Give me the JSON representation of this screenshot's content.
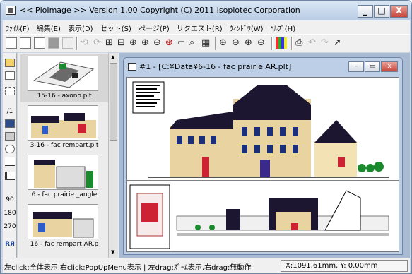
{
  "window": {
    "title": "<< PloImage >>  Version 1.00 Copyright (C) 2011 Isoplotec Corporation",
    "min": "_",
    "max": "□",
    "close": "X"
  },
  "menu": [
    "ﾌｧｲﾙ(F)",
    "編集(E)",
    "表示(D)",
    "セット(S)",
    "ページ(P)",
    "リクエスト(R)",
    "ｳｨﾝﾄﾞｳ(W)",
    "ﾍﾙﾌﾟ(H)"
  ],
  "leftbar": {
    "labels": [
      "/1",
      "90",
      "180",
      "270",
      "RЯ"
    ]
  },
  "thumbnails": [
    {
      "label": "15-16 - axono.plt"
    },
    {
      "label": "3-16 - fac rempart.plt"
    },
    {
      "label": "6 - fac prairie _angle"
    },
    {
      "label": "16 - fac rempart AR.p"
    }
  ],
  "child": {
    "title": "#1 - [C:¥Data¥6-16 - fac prairie AR.plt]"
  },
  "status": {
    "help": "左click:全体表示,右click:PopUpMenu表示 | 左drag:ｽﾞｰﾑ表示,右drag:無動作",
    "coords": "X:1091.61mm, Y: 0.00mm"
  },
  "colors": {
    "accent": "#3a6fb0",
    "building_dark": "#1c1630",
    "facade": "#e8d3a1"
  }
}
